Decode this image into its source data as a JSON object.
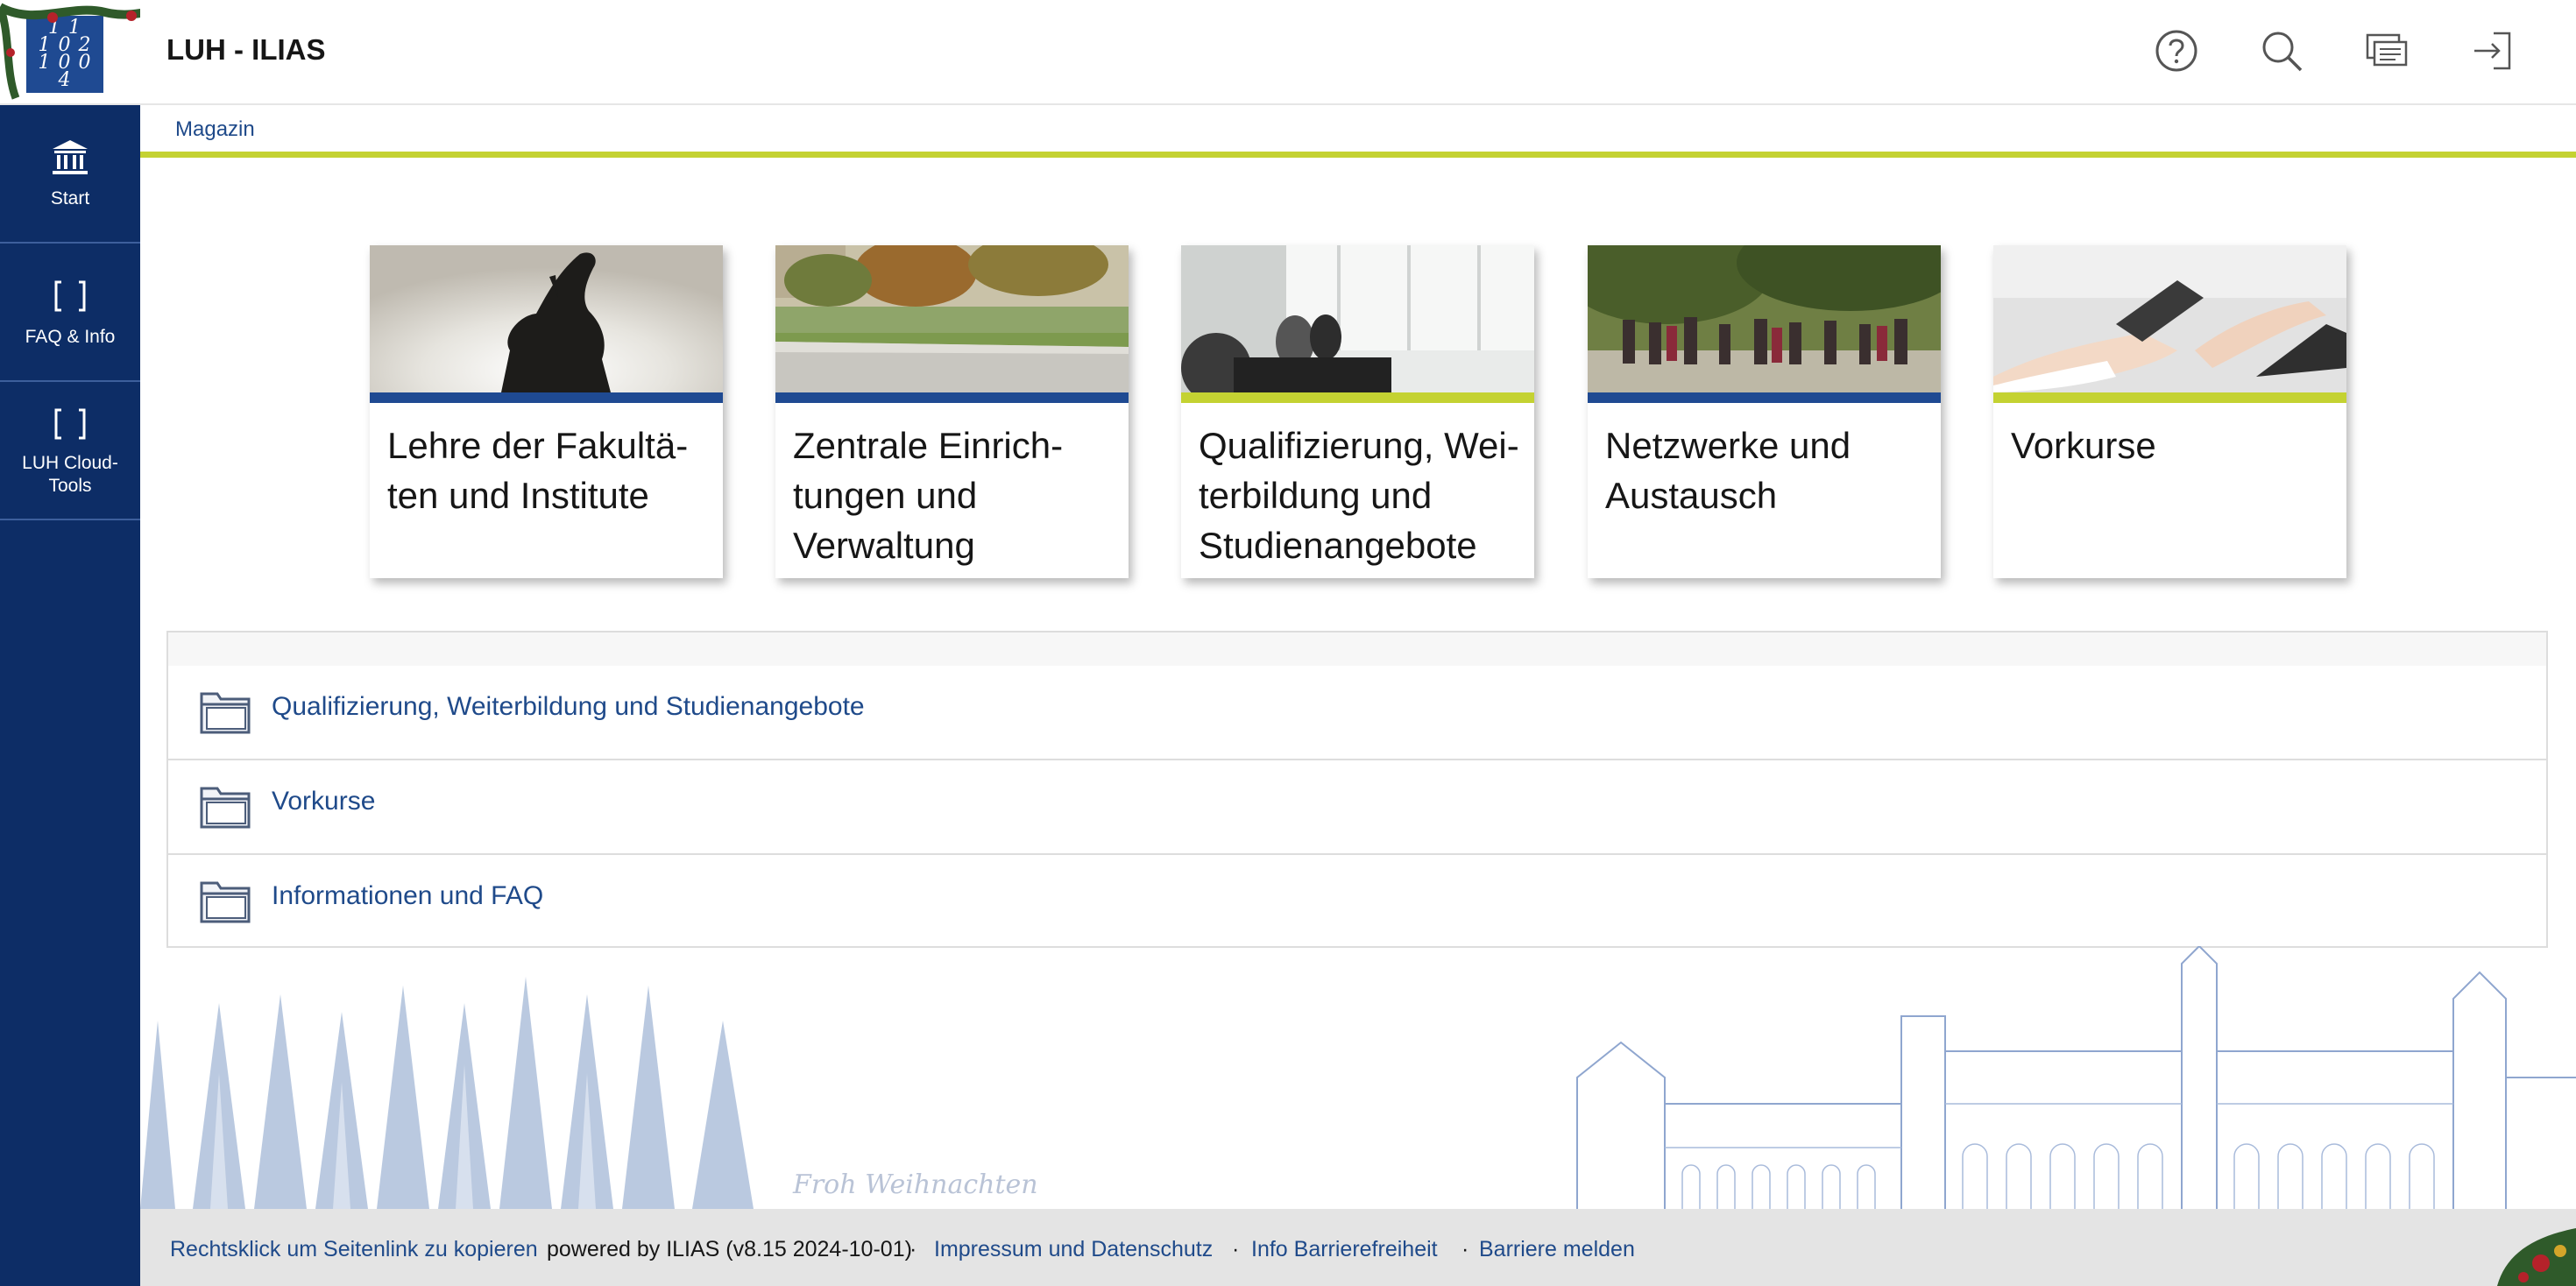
{
  "header": {
    "site_title": "LUH - ILIAS",
    "logo_lines": [
      "1 1",
      "1 0 2",
      "1 0 0 4"
    ],
    "actions": [
      {
        "name": "help",
        "icon": "help-icon"
      },
      {
        "name": "search",
        "icon": "search-icon"
      },
      {
        "name": "notifications",
        "icon": "notification-center-icon"
      },
      {
        "name": "login",
        "icon": "login-icon"
      }
    ]
  },
  "sidebar": {
    "items": [
      {
        "label": "Start",
        "icon": "bank-icon"
      },
      {
        "label": "FAQ & Info",
        "icon": "bracket-icon"
      },
      {
        "label": "LUH Cloud-Tools",
        "icon": "bracket-icon"
      }
    ]
  },
  "breadcrumb": {
    "label": "Magazin"
  },
  "tiles": [
    {
      "title": "Lehre der Fakultä-ten und Institute",
      "accent": "#1f4a92"
    },
    {
      "title": "Zentrale Einrich-tungen und Verwaltung",
      "accent": "#1f4a92"
    },
    {
      "title": "Qualifizierung, Wei-terbildung und Studienangebote",
      "accent": "#c4d232"
    },
    {
      "title": "Netzwerke und Austausch",
      "accent": "#1f4a92"
    },
    {
      "title": "Vorkurse",
      "accent": "#c4d232"
    }
  ],
  "items": [
    {
      "label": "Qualifizierung, Weiterbildung und Studienangebote",
      "icon": "folder-icon"
    },
    {
      "label": "Vorkurse",
      "icon": "folder-icon"
    },
    {
      "label": "Informationen und FAQ",
      "icon": "folder-icon"
    }
  ],
  "decoration": {
    "greeting": "Froh Weihnachten"
  },
  "footer": {
    "permalink": "Rechtsklick um Seitenlink zu kopieren",
    "powered_by": "powered by ILIAS (v8.15 2024-10-01)",
    "separator": "·",
    "imprint": "Impressum und Datenschutz",
    "accessibility_info": "Info Barrierefreiheit",
    "report_barrier": "Barriere melden"
  },
  "colors": {
    "brand_blue": "#0d2d66",
    "link_blue": "#1f4a8a",
    "accent_green": "#c4d232"
  }
}
